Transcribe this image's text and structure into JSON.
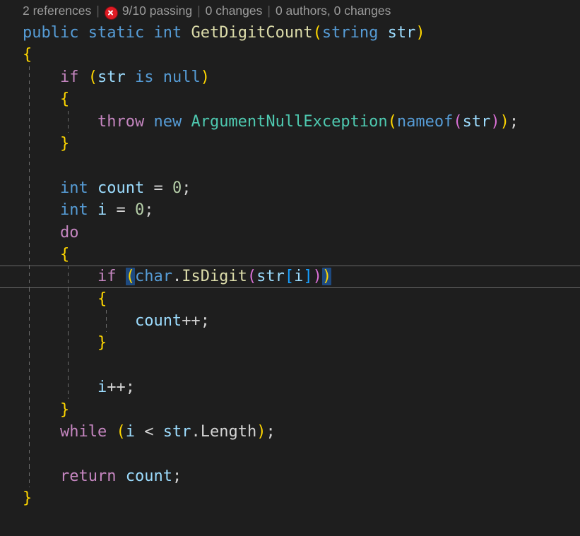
{
  "editor": {
    "background": "#1e1e1e",
    "language": "csharp",
    "theme": "Dark+"
  },
  "codelens": {
    "references": "2 references",
    "separator": "|",
    "tests_icon": "error-circle-icon",
    "tests": "9/10 passing",
    "changes": "0 changes",
    "authors": "0 authors, 0 changes"
  },
  "colors": {
    "control_keyword": "#c586c0",
    "keyword": "#569cd6",
    "type": "#4ec9b0",
    "method": "#dcdcaa",
    "variable": "#9cdcfe",
    "number": "#b5cea8",
    "punctuation": "#d4d4d4",
    "bracket_1": "#ffd700",
    "bracket_2": "#da70d6",
    "bracket_3": "#179fff",
    "bracket_match_bg": "#1e4a80",
    "current_line_border": "#686868",
    "indent_guide": "#6a6a6a",
    "codelens_text": "#999b9b",
    "error_red": "#e01b24"
  },
  "code_lines": [
    {
      "n": 1,
      "guides": 0,
      "current": false,
      "tokens": [
        {
          "t": "public",
          "c": "t-kw"
        },
        {
          "t": " ",
          "c": "t-punc"
        },
        {
          "t": "static",
          "c": "t-kw"
        },
        {
          "t": " ",
          "c": "t-punc"
        },
        {
          "t": "int",
          "c": "t-kw"
        },
        {
          "t": " ",
          "c": "t-punc"
        },
        {
          "t": "GetDigitCount",
          "c": "t-method"
        },
        {
          "t": "(",
          "c": "t-b1"
        },
        {
          "t": "string",
          "c": "t-kw"
        },
        {
          "t": " ",
          "c": "t-punc"
        },
        {
          "t": "str",
          "c": "t-var"
        },
        {
          "t": ")",
          "c": "t-b1"
        }
      ]
    },
    {
      "n": 2,
      "guides": 0,
      "current": false,
      "tokens": [
        {
          "t": "{",
          "c": "t-b1"
        }
      ]
    },
    {
      "n": 3,
      "guides": 1,
      "current": false,
      "tokens": [
        {
          "t": "    ",
          "c": "t-punc"
        },
        {
          "t": "if",
          "c": "t-key"
        },
        {
          "t": " ",
          "c": "t-punc"
        },
        {
          "t": "(",
          "c": "t-b1"
        },
        {
          "t": "str",
          "c": "t-var"
        },
        {
          "t": " ",
          "c": "t-punc"
        },
        {
          "t": "is",
          "c": "t-kw"
        },
        {
          "t": " ",
          "c": "t-punc"
        },
        {
          "t": "null",
          "c": "t-kw"
        },
        {
          "t": ")",
          "c": "t-b1"
        }
      ]
    },
    {
      "n": 4,
      "guides": 1,
      "current": false,
      "tokens": [
        {
          "t": "    ",
          "c": "t-punc"
        },
        {
          "t": "{",
          "c": "t-b1"
        }
      ]
    },
    {
      "n": 5,
      "guides": 2,
      "current": false,
      "tokens": [
        {
          "t": "        ",
          "c": "t-punc"
        },
        {
          "t": "throw",
          "c": "t-key"
        },
        {
          "t": " ",
          "c": "t-punc"
        },
        {
          "t": "new",
          "c": "t-kw"
        },
        {
          "t": " ",
          "c": "t-punc"
        },
        {
          "t": "ArgumentNullException",
          "c": "t-type"
        },
        {
          "t": "(",
          "c": "t-b1"
        },
        {
          "t": "nameof",
          "c": "t-kw"
        },
        {
          "t": "(",
          "c": "t-b2"
        },
        {
          "t": "str",
          "c": "t-var"
        },
        {
          "t": ")",
          "c": "t-b2"
        },
        {
          "t": ")",
          "c": "t-b1"
        },
        {
          "t": ";",
          "c": "t-punc"
        }
      ]
    },
    {
      "n": 6,
      "guides": 1,
      "current": false,
      "tokens": [
        {
          "t": "    ",
          "c": "t-punc"
        },
        {
          "t": "}",
          "c": "t-b1"
        }
      ]
    },
    {
      "n": 7,
      "guides": 1,
      "current": false,
      "tokens": []
    },
    {
      "n": 8,
      "guides": 1,
      "current": false,
      "tokens": [
        {
          "t": "    ",
          "c": "t-punc"
        },
        {
          "t": "int",
          "c": "t-kw"
        },
        {
          "t": " ",
          "c": "t-punc"
        },
        {
          "t": "count",
          "c": "t-var"
        },
        {
          "t": " ",
          "c": "t-punc"
        },
        {
          "t": "=",
          "c": "t-op"
        },
        {
          "t": " ",
          "c": "t-punc"
        },
        {
          "t": "0",
          "c": "t-num"
        },
        {
          "t": ";",
          "c": "t-punc"
        }
      ]
    },
    {
      "n": 9,
      "guides": 1,
      "current": false,
      "tokens": [
        {
          "t": "    ",
          "c": "t-punc"
        },
        {
          "t": "int",
          "c": "t-kw"
        },
        {
          "t": " ",
          "c": "t-punc"
        },
        {
          "t": "i",
          "c": "t-var"
        },
        {
          "t": " ",
          "c": "t-punc"
        },
        {
          "t": "=",
          "c": "t-op"
        },
        {
          "t": " ",
          "c": "t-punc"
        },
        {
          "t": "0",
          "c": "t-num"
        },
        {
          "t": ";",
          "c": "t-punc"
        }
      ]
    },
    {
      "n": 10,
      "guides": 1,
      "current": false,
      "tokens": [
        {
          "t": "    ",
          "c": "t-punc"
        },
        {
          "t": "do",
          "c": "t-key"
        }
      ]
    },
    {
      "n": 11,
      "guides": 1,
      "current": false,
      "tokens": [
        {
          "t": "    ",
          "c": "t-punc"
        },
        {
          "t": "{",
          "c": "t-b1"
        }
      ]
    },
    {
      "n": 12,
      "guides": 2,
      "current": true,
      "tokens": [
        {
          "t": "        ",
          "c": "t-punc"
        },
        {
          "t": "if",
          "c": "t-key"
        },
        {
          "t": " ",
          "c": "t-punc"
        },
        {
          "t": "(",
          "c": "t-b1",
          "match": true
        },
        {
          "t": "char",
          "c": "t-kw"
        },
        {
          "t": ".",
          "c": "t-punc"
        },
        {
          "t": "IsDigit",
          "c": "t-method"
        },
        {
          "t": "(",
          "c": "t-b2"
        },
        {
          "t": "str",
          "c": "t-var"
        },
        {
          "t": "[",
          "c": "t-b3"
        },
        {
          "t": "i",
          "c": "t-var"
        },
        {
          "t": "]",
          "c": "t-b3"
        },
        {
          "t": ")",
          "c": "t-b2"
        },
        {
          "t": ")",
          "c": "t-b1",
          "match": true
        }
      ]
    },
    {
      "n": 13,
      "guides": 2,
      "current": false,
      "tokens": [
        {
          "t": "        ",
          "c": "t-punc"
        },
        {
          "t": "{",
          "c": "t-b1"
        }
      ]
    },
    {
      "n": 14,
      "guides": 3,
      "current": false,
      "tokens": [
        {
          "t": "            ",
          "c": "t-punc"
        },
        {
          "t": "count",
          "c": "t-var"
        },
        {
          "t": "++",
          "c": "t-op"
        },
        {
          "t": ";",
          "c": "t-punc"
        }
      ]
    },
    {
      "n": 15,
      "guides": 2,
      "current": false,
      "tokens": [
        {
          "t": "        ",
          "c": "t-punc"
        },
        {
          "t": "}",
          "c": "t-b1"
        }
      ]
    },
    {
      "n": 16,
      "guides": 2,
      "current": false,
      "tokens": []
    },
    {
      "n": 17,
      "guides": 2,
      "current": false,
      "tokens": [
        {
          "t": "        ",
          "c": "t-punc"
        },
        {
          "t": "i",
          "c": "t-var"
        },
        {
          "t": "++",
          "c": "t-op"
        },
        {
          "t": ";",
          "c": "t-punc"
        }
      ]
    },
    {
      "n": 18,
      "guides": 1,
      "current": false,
      "tokens": [
        {
          "t": "    ",
          "c": "t-punc"
        },
        {
          "t": "}",
          "c": "t-b1"
        }
      ]
    },
    {
      "n": 19,
      "guides": 1,
      "current": false,
      "tokens": [
        {
          "t": "    ",
          "c": "t-punc"
        },
        {
          "t": "while",
          "c": "t-key"
        },
        {
          "t": " ",
          "c": "t-punc"
        },
        {
          "t": "(",
          "c": "t-b1"
        },
        {
          "t": "i",
          "c": "t-var"
        },
        {
          "t": " ",
          "c": "t-punc"
        },
        {
          "t": "<",
          "c": "t-op"
        },
        {
          "t": " ",
          "c": "t-punc"
        },
        {
          "t": "str",
          "c": "t-var"
        },
        {
          "t": ".",
          "c": "t-punc"
        },
        {
          "t": "Length",
          "c": "t-prop"
        },
        {
          "t": ")",
          "c": "t-b1"
        },
        {
          "t": ";",
          "c": "t-punc"
        }
      ]
    },
    {
      "n": 20,
      "guides": 1,
      "current": false,
      "tokens": []
    },
    {
      "n": 21,
      "guides": 1,
      "current": false,
      "tokens": [
        {
          "t": "    ",
          "c": "t-punc"
        },
        {
          "t": "return",
          "c": "t-key"
        },
        {
          "t": " ",
          "c": "t-punc"
        },
        {
          "t": "count",
          "c": "t-var"
        },
        {
          "t": ";",
          "c": "t-punc"
        }
      ]
    },
    {
      "n": 22,
      "guides": 0,
      "current": false,
      "tokens": [
        {
          "t": "}",
          "c": "t-b1"
        }
      ]
    }
  ]
}
